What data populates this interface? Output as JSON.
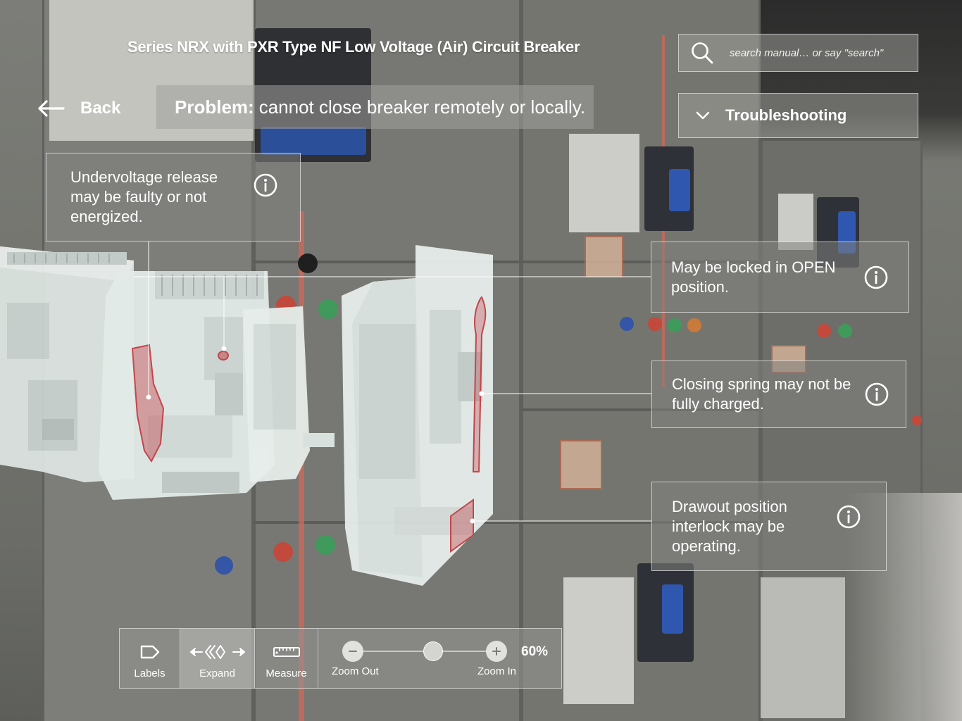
{
  "header": {
    "title": "Series NRX with PXR Type NF Low Voltage (Air) Circuit Breaker",
    "back_label": "Back"
  },
  "problem": {
    "label": "Problem:",
    "text": "cannot close breaker remotely or locally."
  },
  "search": {
    "placeholder": "search manual… or say \"search\""
  },
  "section_dropdown": {
    "label": "Troubleshooting"
  },
  "callouts": [
    {
      "text": "Undervoltage release may be faulty or not energized."
    },
    {
      "text": "May be locked in OPEN position."
    },
    {
      "text": "Closing spring may not be fully charged."
    },
    {
      "text": "Drawout position interlock may be operating."
    }
  ],
  "toolbar": {
    "labels": "Labels",
    "expand": "Expand",
    "measure": "Measure",
    "zoom_out": "Zoom Out",
    "zoom_in": "Zoom In",
    "zoom_percent": "60%",
    "zoom_level": 0.6
  },
  "colors": {
    "highlight": "#c8434a",
    "model_body": "#dfe7e4"
  }
}
